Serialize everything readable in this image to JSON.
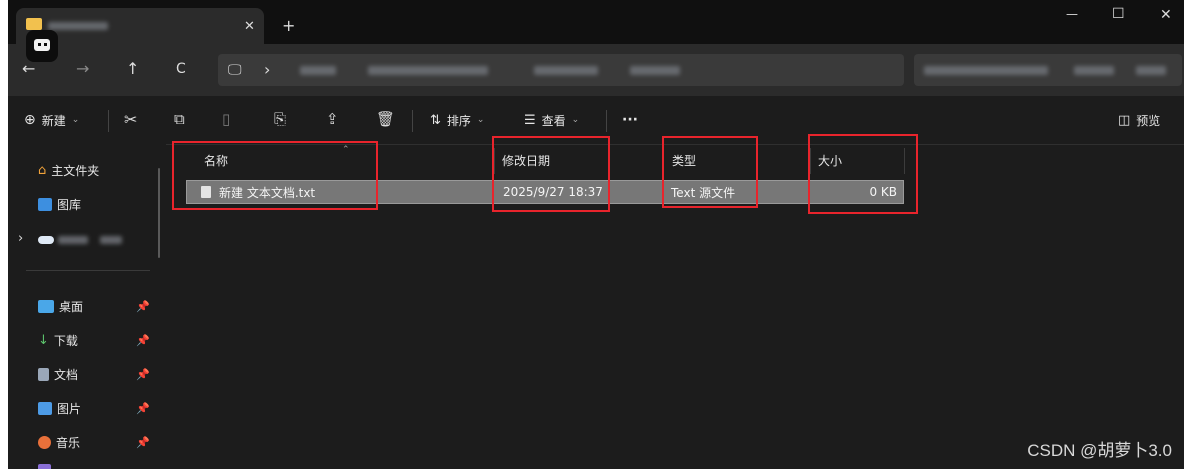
{
  "window": {
    "controls": {
      "minimize": "—",
      "maximize": "☐",
      "close": "✕"
    },
    "tab": {
      "close": "✕",
      "new_tab": "+"
    }
  },
  "nav": {
    "back": "←",
    "forward": "→",
    "up": "↑",
    "refresh": "C",
    "monitor": "🖵",
    "chevron": "›"
  },
  "toolbar": {
    "new_label": "新建",
    "sort_label": "排序",
    "view_label": "查看",
    "more_label": "···",
    "preview_label": "预览"
  },
  "sidebar": {
    "top_items": [
      {
        "label": "主文件夹",
        "icon": "home-icon"
      },
      {
        "label": "图库",
        "icon": "gallery-icon"
      }
    ],
    "pinned_items": [
      {
        "label": "桌面",
        "icon": "desktop-icon"
      },
      {
        "label": "下载",
        "icon": "download-icon"
      },
      {
        "label": "文档",
        "icon": "document-icon"
      },
      {
        "label": "图片",
        "icon": "pictures-icon"
      },
      {
        "label": "音乐",
        "icon": "music-icon"
      }
    ]
  },
  "columns": {
    "name": "名称",
    "modified": "修改日期",
    "type": "类型",
    "size": "大小"
  },
  "files": [
    {
      "name": "新建 文本文档.txt",
      "modified": "2025/9/27 18:37",
      "type": "Text 源文件",
      "size": "0 KB"
    }
  ],
  "watermark": "CSDN @胡萝卜3.0",
  "colors": {
    "highlight": "#e8242c",
    "background": "#1c1c1c",
    "selected_row": "#777777"
  }
}
